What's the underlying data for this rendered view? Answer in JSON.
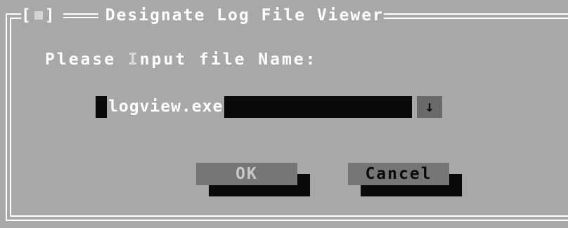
{
  "window": {
    "title": "Designate Log File Viewer",
    "close_bracket_left": "[",
    "close_bracket_right": "]"
  },
  "prompt": {
    "label_before": "Please ",
    "label_hotkey": "I",
    "label_after": "nput file Name:"
  },
  "file_input": {
    "value": "logview.exe",
    "dropdown_glyph": "↓"
  },
  "buttons": {
    "ok_label": "OK",
    "cancel_label": "Cancel"
  },
  "colors": {
    "background": "#a8a8a8",
    "text": "#ffffff",
    "field": "#0a0a0a",
    "button_face": "#767676",
    "button_shadow": "#0a0a0a"
  }
}
